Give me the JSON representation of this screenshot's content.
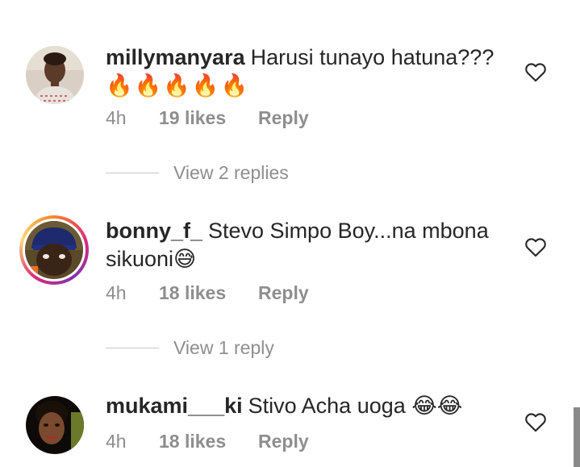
{
  "comments": [
    {
      "username": "millymanyara",
      "text": "Harusi tunayo hatuna???",
      "emoji": "🔥🔥🔥🔥🔥",
      "time": "4h",
      "likes": "19 likes",
      "reply": "Reply",
      "view_replies": "View 2 replies",
      "avatar": "woman-photo-avatar"
    },
    {
      "username": "bonny_f_",
      "text": "Stevo Simpo Boy...na mbona sikuoni😅",
      "time": "4h",
      "likes": "18 likes",
      "reply": "Reply",
      "view_replies": "View 1 reply",
      "avatar": "man-photo-avatar-story-ring"
    },
    {
      "username": "mukami___ki",
      "text": "Stivo Acha uoga 😂😂",
      "time": "4h",
      "likes": "18 likes",
      "reply": "Reply",
      "avatar": "woman-photo-avatar"
    }
  ],
  "icons": {
    "like": "heart-outline-icon"
  },
  "colors": {
    "text": "#262626",
    "secondary": "#8e8e8e",
    "story_ring_start": "#f58529",
    "story_ring_end": "#dd2a7b"
  }
}
